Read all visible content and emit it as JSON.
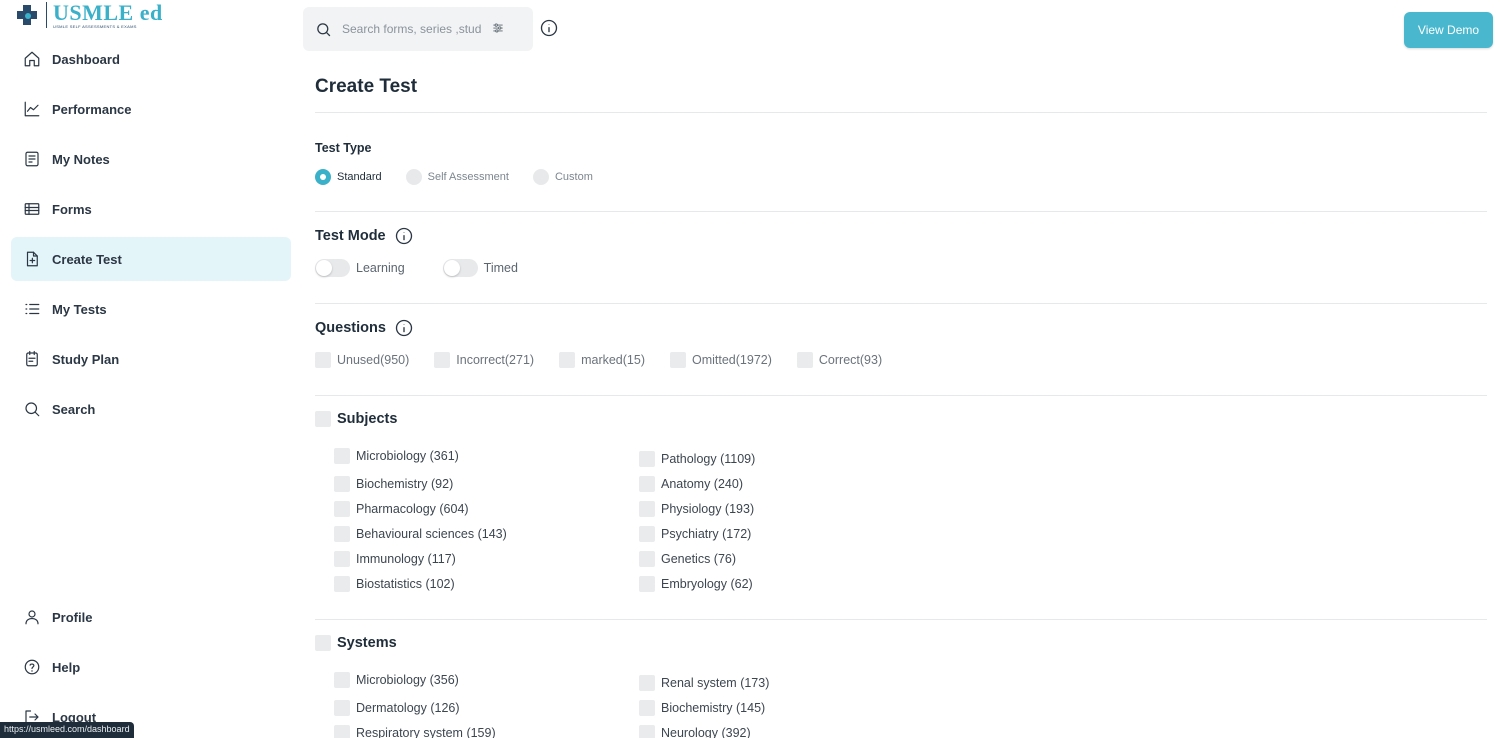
{
  "brand": {
    "name": "USMLE ed",
    "tagline": "USMLE SELF ASSESSMENTS & EXAMS"
  },
  "sidebar": {
    "items": [
      {
        "label": "Dashboard",
        "icon": "home-icon"
      },
      {
        "label": "Performance",
        "icon": "chart-line-icon"
      },
      {
        "label": "My Notes",
        "icon": "notes-icon"
      },
      {
        "label": "Forms",
        "icon": "table-icon"
      },
      {
        "label": "Create Test",
        "icon": "file-plus-icon",
        "active": true
      },
      {
        "label": "My Tests",
        "icon": "list-icon"
      },
      {
        "label": "Study Plan",
        "icon": "calendar-clipboard-icon"
      },
      {
        "label": "Search",
        "icon": "search-icon"
      }
    ],
    "bottom_items": [
      {
        "label": "Profile",
        "icon": "user-icon"
      },
      {
        "label": "Help",
        "icon": "help-circle-icon"
      },
      {
        "label": "Logout",
        "icon": "logout-icon"
      }
    ],
    "status_url": "https://usmleed.com/dashboard"
  },
  "header": {
    "search_placeholder": "Search forms, series ,stud",
    "view_demo_label": "View Demo"
  },
  "main": {
    "title": "Create Test",
    "test_type": {
      "label": "Test Type",
      "options": [
        "Standard",
        "Self Assessment",
        "Custom"
      ],
      "selected": "Standard"
    },
    "test_mode": {
      "label": "Test Mode",
      "toggles": [
        {
          "label": "Learning",
          "on": false
        },
        {
          "label": "Timed",
          "on": false
        }
      ]
    },
    "questions": {
      "label": "Questions",
      "options": [
        "Unused(950)",
        "Incorrect(271)",
        "marked(15)",
        "Omitted(1972)",
        "Correct(93)"
      ]
    },
    "subjects": {
      "label": "Subjects",
      "left": [
        "Microbiology (361)",
        "Biochemistry (92)",
        "Pharmacology (604)",
        "Behavioural sciences (143)",
        "Immunology (117)",
        "Biostatistics (102)"
      ],
      "right": [
        "Pathology (1109)",
        "Anatomy (240)",
        "Physiology (193)",
        "Psychiatry (172)",
        "Genetics (76)",
        "Embryology (62)"
      ]
    },
    "systems": {
      "label": "Systems",
      "left": [
        "Microbiology (356)",
        "Dermatology (126)",
        "Respiratory system (159)"
      ],
      "right": [
        "Renal system (173)",
        "Biochemistry (145)",
        "Neurology (392)"
      ]
    }
  },
  "colors": {
    "accent": "#3bb0c9",
    "button": "#49b8cf",
    "active_bg": "#e4f5f9",
    "text": "#1f2d3a"
  }
}
